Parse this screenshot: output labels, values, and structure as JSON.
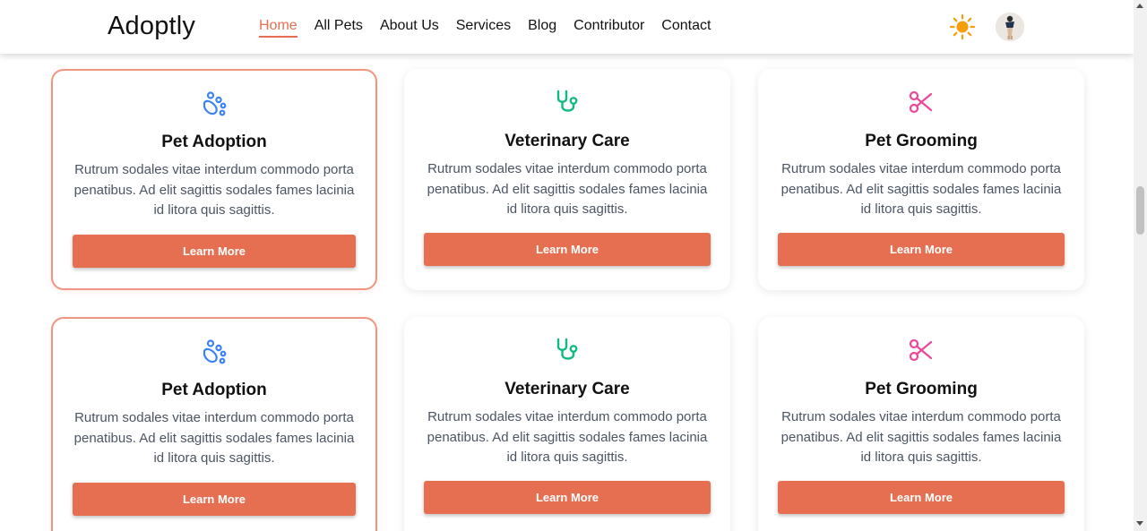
{
  "header": {
    "logo": "Adoptly",
    "nav": [
      {
        "label": "Home",
        "active": true
      },
      {
        "label": "All Pets",
        "active": false
      },
      {
        "label": "About Us",
        "active": false
      },
      {
        "label": "Services",
        "active": false
      },
      {
        "label": "Blog",
        "active": false
      },
      {
        "label": "Contributor",
        "active": false
      },
      {
        "label": "Contact",
        "active": false
      }
    ],
    "theme_icon": "sun-icon",
    "avatar_icon": "user-avatar"
  },
  "colors": {
    "accent": "#e76f51",
    "card_border_highlight": "#f0957f",
    "paw_icon": "#3b82f6",
    "stethoscope_icon": "#10b981",
    "scissors_icon": "#ec4899",
    "sun_icon": "#f59e0b"
  },
  "services": [
    {
      "icon": "paw-icon",
      "title": "Pet Adoption",
      "description": "Rutrum sodales vitae interdum commodo porta penatibus. Ad elit sagittis sodales fames lacinia id litora quis sagittis.",
      "button": "Learn More",
      "highlighted": true
    },
    {
      "icon": "stethoscope-icon",
      "title": "Veterinary Care",
      "description": "Rutrum sodales vitae interdum commodo porta penatibus. Ad elit sagittis sodales fames lacinia id litora quis sagittis.",
      "button": "Learn More",
      "highlighted": false
    },
    {
      "icon": "scissors-icon",
      "title": "Pet Grooming",
      "description": "Rutrum sodales vitae interdum commodo porta penatibus. Ad elit sagittis sodales fames lacinia id litora quis sagittis.",
      "button": "Learn More",
      "highlighted": false
    },
    {
      "icon": "paw-icon",
      "title": "Pet Adoption",
      "description": "Rutrum sodales vitae interdum commodo porta penatibus. Ad elit sagittis sodales fames lacinia id litora quis sagittis.",
      "button": "Learn More",
      "highlighted": true
    },
    {
      "icon": "stethoscope-icon",
      "title": "Veterinary Care",
      "description": "Rutrum sodales vitae interdum commodo porta penatibus. Ad elit sagittis sodales fames lacinia id litora quis sagittis.",
      "button": "Learn More",
      "highlighted": false
    },
    {
      "icon": "scissors-icon",
      "title": "Pet Grooming",
      "description": "Rutrum sodales vitae interdum commodo porta penatibus. Ad elit sagittis sodales fames lacinia id litora quis sagittis.",
      "button": "Learn More",
      "highlighted": false
    }
  ]
}
